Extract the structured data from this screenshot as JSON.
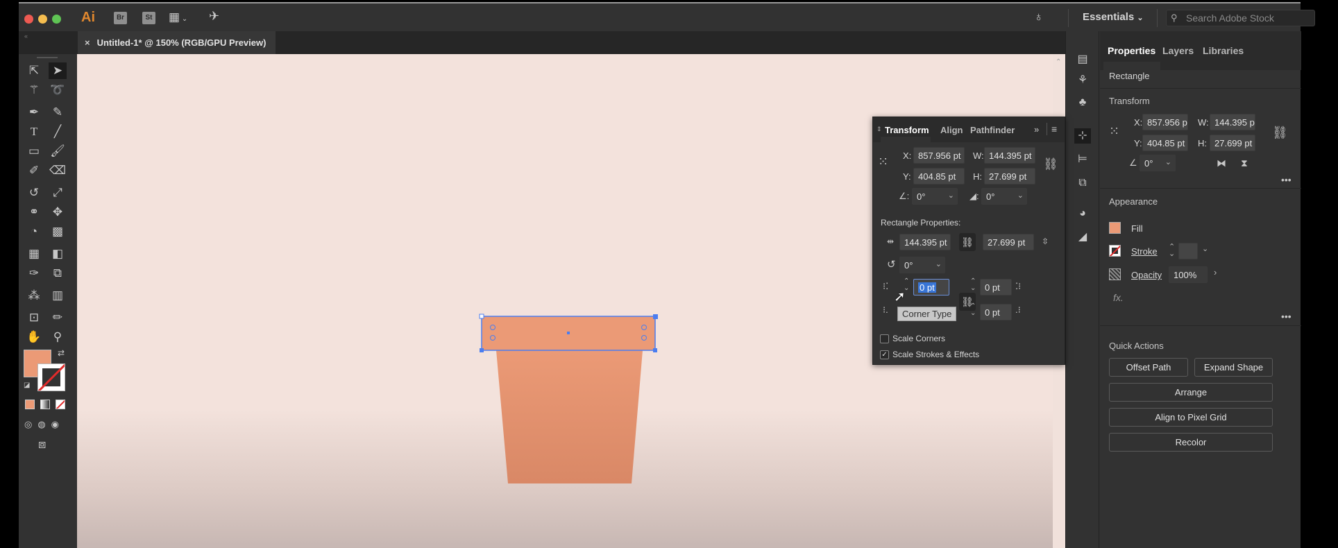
{
  "app": {
    "logo": "Ai",
    "bridge": "Br",
    "stock": "St",
    "workspace": "Essentials",
    "search_placeholder": "Search Adobe Stock"
  },
  "document": {
    "tab_title": "Untitled-1* @ 150% (RGB/GPU Preview)",
    "close": "×"
  },
  "properties_panel": {
    "tabs": [
      "Properties",
      "Layers",
      "Libraries"
    ],
    "selection_type": "Rectangle",
    "transform": {
      "title": "Transform",
      "x_label": "X:",
      "x": "857.956 p",
      "y_label": "Y:",
      "y": "404.85 pt",
      "w_label": "W:",
      "w": "144.395 p",
      "h_label": "H:",
      "h": "27.699 pt",
      "angle": "0°"
    },
    "appearance": {
      "title": "Appearance",
      "fill_label": "Fill",
      "stroke_label": "Stroke",
      "opacity_label": "Opacity",
      "opacity": "100%",
      "fx": "fx."
    },
    "quick_actions": {
      "title": "Quick Actions",
      "offset_path": "Offset Path",
      "expand_shape": "Expand Shape",
      "arrange": "Arrange",
      "align_pixel_grid": "Align to Pixel Grid",
      "recolor": "Recolor"
    }
  },
  "transform_panel": {
    "tabs": [
      "Transform",
      "Align",
      "Pathfinder"
    ],
    "x_label": "X:",
    "x": "857.956 pt",
    "y_label": "Y:",
    "y": "404.85 pt",
    "w_label": "W:",
    "w": "144.395 pt",
    "h_label": "H:",
    "h": "27.699 pt",
    "rotate": "0°",
    "shear": "0°",
    "rect_props_title": "Rectangle Properties:",
    "rect_width": "144.395 pt",
    "rect_height": "27.699 pt",
    "rect_angle": "0°",
    "corner_tl": "0 pt",
    "corner_tr": "0 pt",
    "corner_br": "0 pt",
    "tooltip": "Corner Type",
    "scale_corners": "Scale Corners",
    "scale_corners_checked": false,
    "scale_strokes": "Scale Strokes & Effects",
    "scale_strokes_checked": true
  },
  "colors": {
    "fill": "#eb9a76",
    "accent": "#4a7df0",
    "pot_top": "#eb9a76",
    "pot_bottom": "#d98866",
    "canvas": "#f3e2dc"
  }
}
